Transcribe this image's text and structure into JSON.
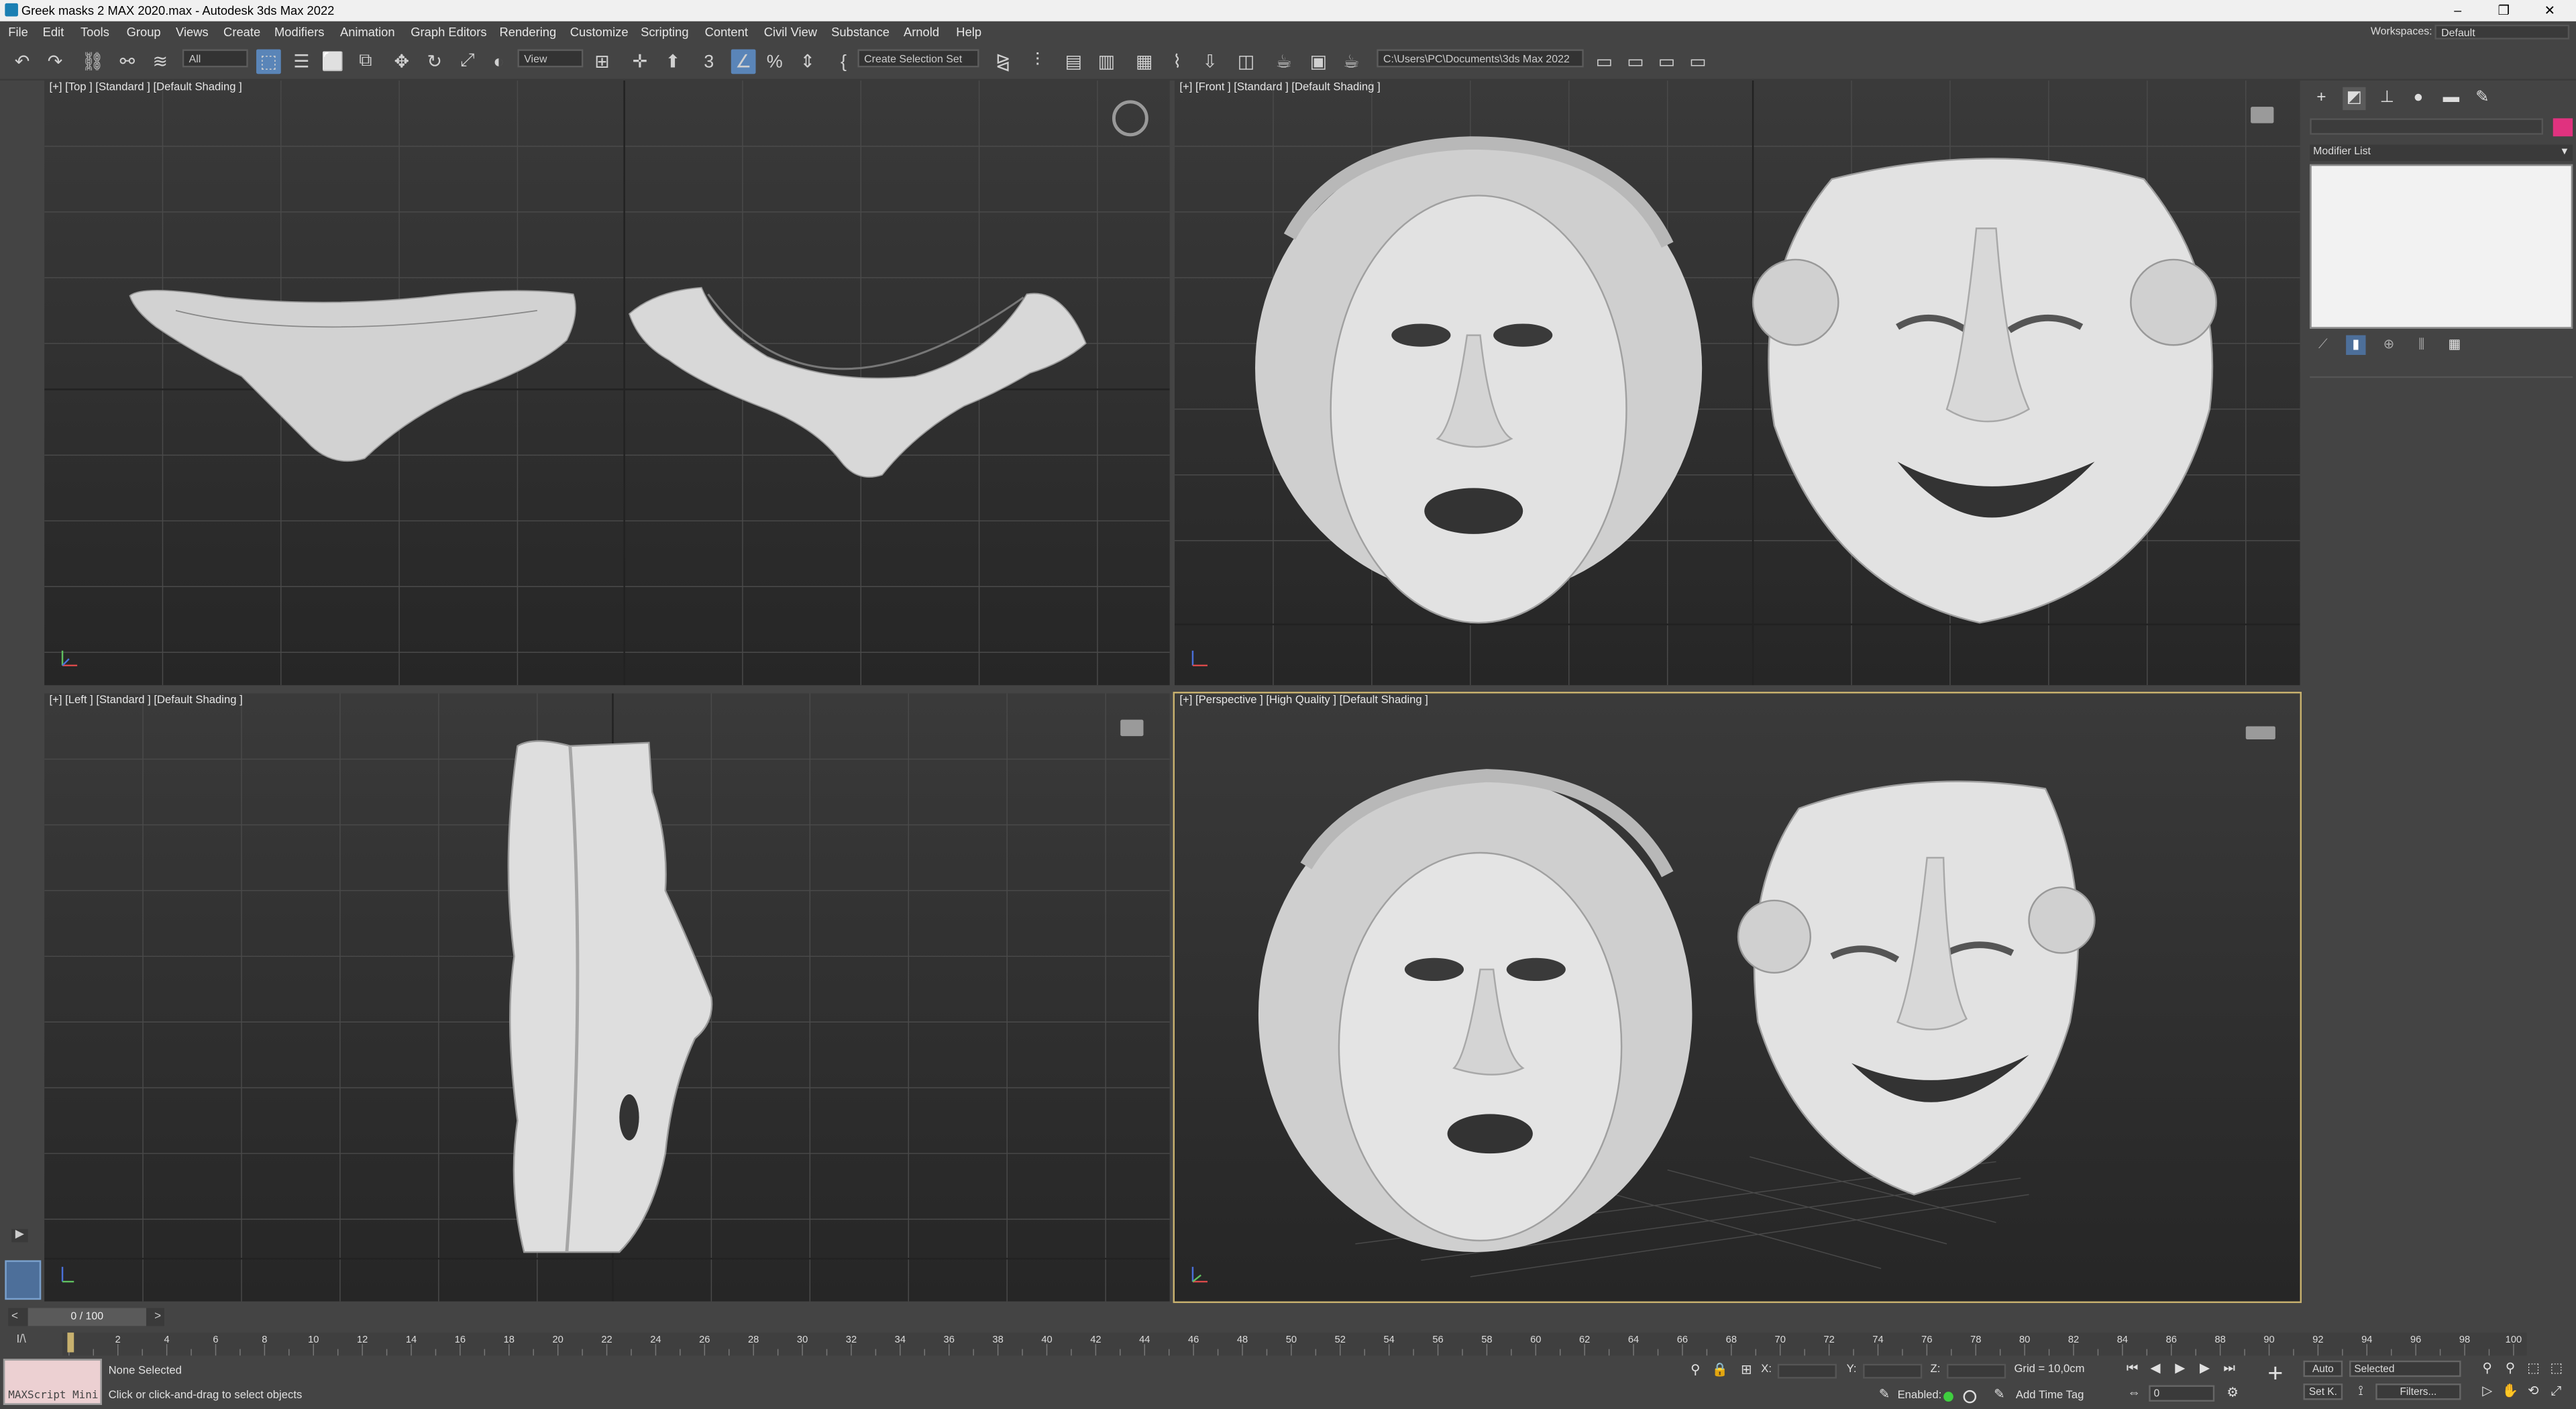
{
  "window": {
    "title": "Greek masks 2 MAX 2020.max - Autodesk 3ds Max 2022",
    "min": "–",
    "restore": "❐",
    "close": "✕"
  },
  "menu": {
    "items": [
      "File",
      "Edit",
      "Tools",
      "Group",
      "Views",
      "Create",
      "Modifiers",
      "Animation",
      "Graph Editors",
      "Rendering",
      "Customize",
      "Scripting",
      "Content",
      "Civil View",
      "Substance",
      "Arnold",
      "Help"
    ],
    "workspaces_label": "Workspaces:",
    "workspaces_value": "Default"
  },
  "toolbar": {
    "filter_select": "All",
    "view_select": "View",
    "selection_set": "Create Selection Set",
    "project_path": "C:\\Users\\PC\\Documents\\3ds Max 2022"
  },
  "viewports": {
    "top": "[+] [Top ] [Standard ] [Default Shading ]",
    "front": "[+] [Front ] [Standard ] [Default Shading ]",
    "left": "[+] [Left ] [Standard ] [Default Shading ]",
    "perspective": "[+] [Perspective ] [High Quality ] [Default Shading ]"
  },
  "command_panel": {
    "modifier_list": "Modifier List"
  },
  "timeline": {
    "frame": "0 / 100",
    "ticks": [
      "0",
      "2",
      "4",
      "6",
      "8",
      "10",
      "12",
      "14",
      "16",
      "18",
      "20",
      "22",
      "24",
      "26",
      "28",
      "30",
      "32",
      "34",
      "36",
      "38",
      "40",
      "42",
      "44",
      "46",
      "48",
      "50",
      "52",
      "54",
      "56",
      "58",
      "60",
      "62",
      "64",
      "66",
      "68",
      "70",
      "72",
      "74",
      "76",
      "78",
      "80",
      "82",
      "84",
      "86",
      "88",
      "90",
      "92",
      "94",
      "96",
      "98",
      "100"
    ]
  },
  "status": {
    "maxscript": "MAXScript Mini",
    "selection": "None Selected",
    "prompt": "Click or click-and-drag to select objects",
    "x_label": "X:",
    "y_label": "Y:",
    "z_label": "Z:",
    "grid": "Grid = 10,0cm",
    "enabled_label": "Enabled:",
    "add_time_tag": "Add Time Tag",
    "auto": "Auto",
    "set_k": "Set K.",
    "selected": "Selected",
    "filters": "Filters...",
    "frame_value": "0"
  },
  "colors": {
    "accent": "#5a85b8",
    "object_color": "#e0327f",
    "perspective_border": "#c8b16e"
  }
}
